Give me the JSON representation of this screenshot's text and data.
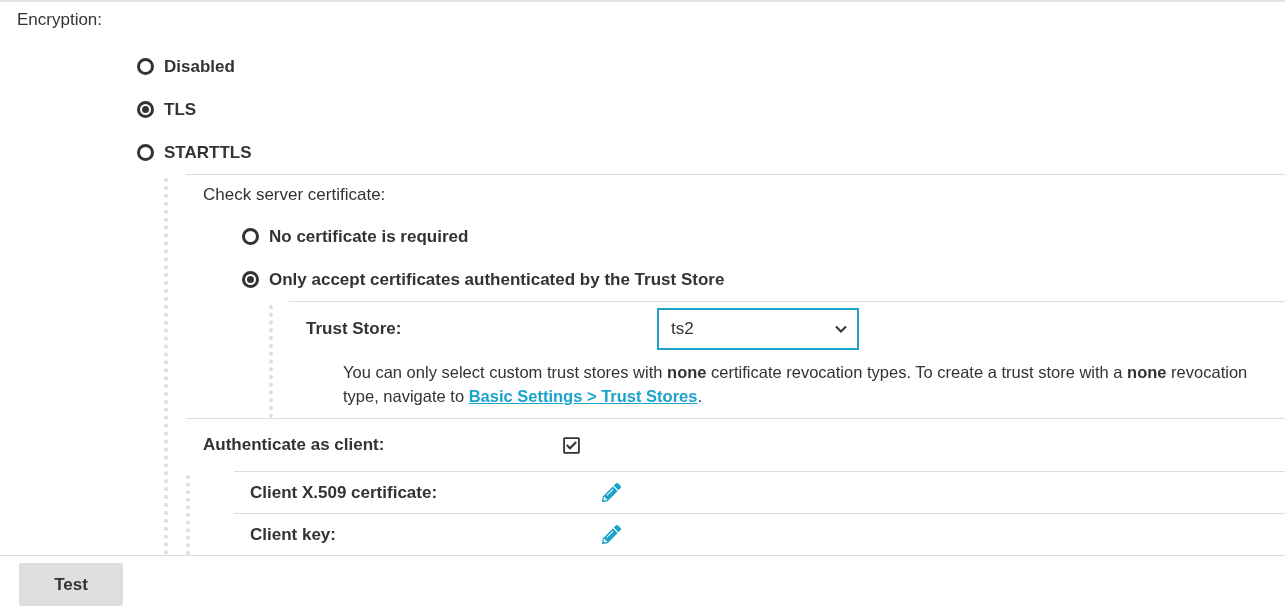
{
  "encryption": {
    "label": "Encryption:",
    "options": [
      {
        "label": "Disabled",
        "selected": false
      },
      {
        "label": "TLS",
        "selected": true
      },
      {
        "label": "STARTTLS",
        "selected": false
      }
    ]
  },
  "server_certificate": {
    "label": "Check server certificate:",
    "options": [
      {
        "label": "No certificate is required",
        "selected": false
      },
      {
        "label": "Only accept certificates authenticated by the Trust Store",
        "selected": true
      }
    ]
  },
  "trust_store": {
    "label": "Trust Store:",
    "value": "ts2",
    "help": "You can only select custom trust stores with **none** certificate revocation types. To create a trust store with a **none** revocation type, navigate to ",
    "link": "Basic Settings > Trust Stores",
    "help_end": "."
  },
  "authenticate": {
    "label": "Authenticate as client:",
    "checked": true
  },
  "client_fields": [
    {
      "label": "Client X.509 certificate:"
    },
    {
      "label": "Client key:"
    }
  ],
  "buttons": [
    "Test"
  ]
}
